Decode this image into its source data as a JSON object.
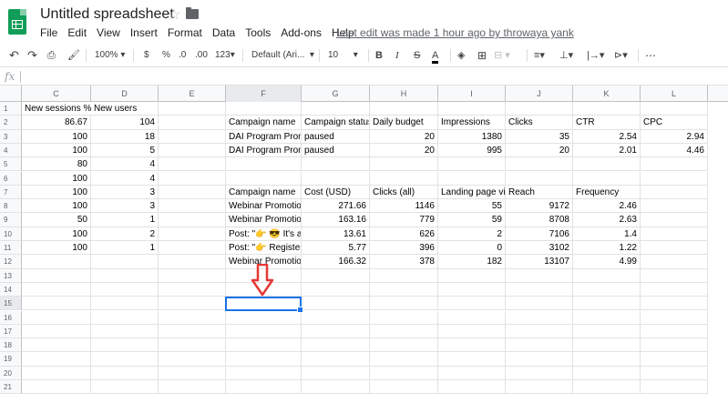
{
  "title": "Untitled spreadsheet",
  "menu": [
    "File",
    "Edit",
    "View",
    "Insert",
    "Format",
    "Data",
    "Tools",
    "Add-ons",
    "Help"
  ],
  "last_edit": "Last edit was made 1 hour ago by throwaya yank",
  "toolbar": {
    "zoom": "100%",
    "currency": "$",
    "percent": "%",
    "dec_decrease": ".0",
    "dec_increase": ".00",
    "format_123": "123",
    "font": "Default (Ari...",
    "font_size": "10",
    "bold": "B",
    "italic": "I",
    "strike": "S",
    "text_color": "A",
    "more": "⋯"
  },
  "formula_bar": {
    "fx": "fx",
    "value": ""
  },
  "columns": [
    "C",
    "D",
    "E",
    "F",
    "G",
    "H",
    "I",
    "J",
    "K",
    "L"
  ],
  "selected_column": "F",
  "rows": [
    "1",
    "2",
    "3",
    "4",
    "5",
    "6",
    "7",
    "8",
    "9",
    "10",
    "11",
    "12",
    "13",
    "14",
    "15",
    "16",
    "17",
    "18",
    "19",
    "20",
    "21"
  ],
  "selected_row": "15",
  "colors": {
    "selection": "#1a73e8",
    "arrow": "#e53935",
    "header_bg": "#f8f9fa",
    "logo": "#0f9d58"
  },
  "sheet": {
    "C": [
      "New sessions %",
      "86.67",
      "100",
      "100",
      "80",
      "100",
      "100",
      "100",
      "50",
      "100",
      "100"
    ],
    "D": [
      "New users",
      "104",
      "18",
      "5",
      "4",
      "4",
      "3",
      "3",
      "1",
      "2",
      "1"
    ],
    "F": [
      "",
      "Campaign name",
      "DAI Program Prom",
      "DAI Program Prom",
      "",
      "",
      "Campaign name",
      "Webinar Promotior",
      "Webinar Promotior",
      "Post: \"👉 😎 It's al",
      "Post: \"👉 Register",
      "Webinar Promotior"
    ],
    "G": [
      "",
      "Campaign status",
      "paused",
      "paused",
      "",
      "",
      "Cost (USD)",
      "271.66",
      "163.16",
      "13.61",
      "5.77",
      "166.32"
    ],
    "H": [
      "",
      "Daily budget",
      "20",
      "20",
      "",
      "",
      "Clicks (all)",
      "1146",
      "779",
      "626",
      "396",
      "378"
    ],
    "I": [
      "",
      "Impressions",
      "1380",
      "995",
      "",
      "",
      "Landing page vie",
      "55",
      "59",
      "2",
      "0",
      "182"
    ],
    "J": [
      "",
      "Clicks",
      "35",
      "20",
      "",
      "",
      "Reach",
      "9172",
      "8708",
      "7106",
      "3102",
      "13107"
    ],
    "K": [
      "",
      "CTR",
      "2.54",
      "2.01",
      "",
      "",
      "Frequency",
      "2.46",
      "2.63",
      "1.4",
      "1.22",
      "4.99"
    ],
    "L": [
      "",
      "CPC",
      "2.94",
      "4.46",
      "",
      "",
      "",
      "",
      "",
      "",
      "",
      ""
    ]
  }
}
